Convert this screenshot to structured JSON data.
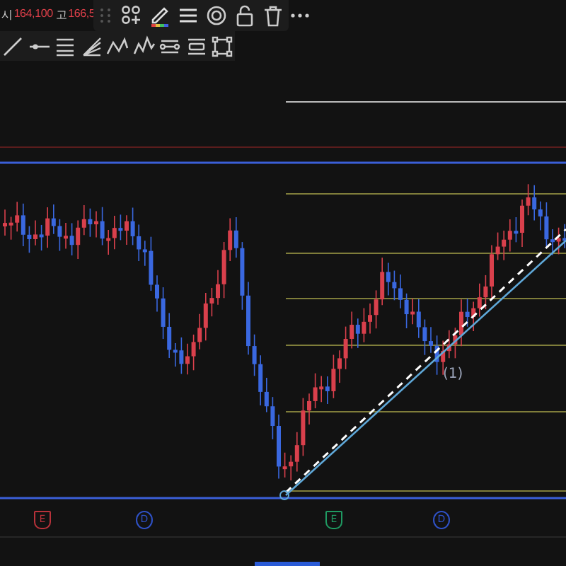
{
  "legend": [
    {
      "label": "시",
      "value": "164,100"
    },
    {
      "label": "고",
      "value": "166,5"
    }
  ],
  "wave_label": "(1)",
  "event_markers": [
    {
      "label": "E",
      "color": "#b8323a",
      "kind": "earnings"
    },
    {
      "label": "D",
      "color": "#2f52c8",
      "kind": "dividend"
    },
    {
      "label": "E",
      "color": "#1f9a62",
      "kind": "earnings"
    },
    {
      "label": "D",
      "color": "#2f52c8",
      "kind": "dividend"
    }
  ]
}
